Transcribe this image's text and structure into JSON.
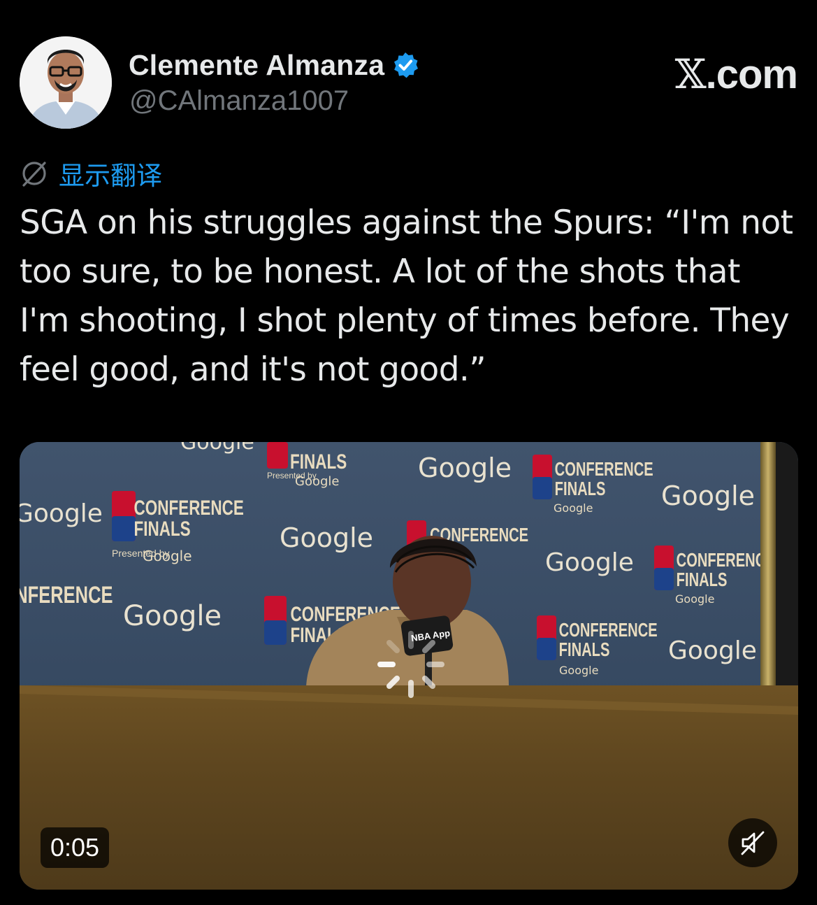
{
  "author": {
    "display_name": "Clemente Almanza",
    "handle": "@CAlmanza1007",
    "verified": true,
    "avatar_icon": "profile-photo"
  },
  "site": {
    "logo_mark": "𝕏",
    "logo_text": ".com"
  },
  "translate": {
    "icon": "translate-globe-icon",
    "label": "显示翻译"
  },
  "tweet": {
    "text": "SGA on his struggles against the Spurs: “I'm not too sure, to be honest. A lot of the shots that I'm shooting, I shot plenty of times before. They feel good, and it's not good.”"
  },
  "media": {
    "type": "video",
    "duration": "0:05",
    "mute_icon": "speaker-muted-icon",
    "loading_icon": "spinner-icon",
    "backdrop_text": {
      "brand": "Google",
      "event_line1": "CONFERENCE",
      "event_line2": "FINALS",
      "presented": "Presented by",
      "league": "NBA",
      "mic_label": "NBA App"
    }
  },
  "colors": {
    "background": "#000000",
    "text": "#e7e9ea",
    "secondary_text": "#71767b",
    "link": "#1d9bf0",
    "verified_badge": "#1d9bf0"
  }
}
